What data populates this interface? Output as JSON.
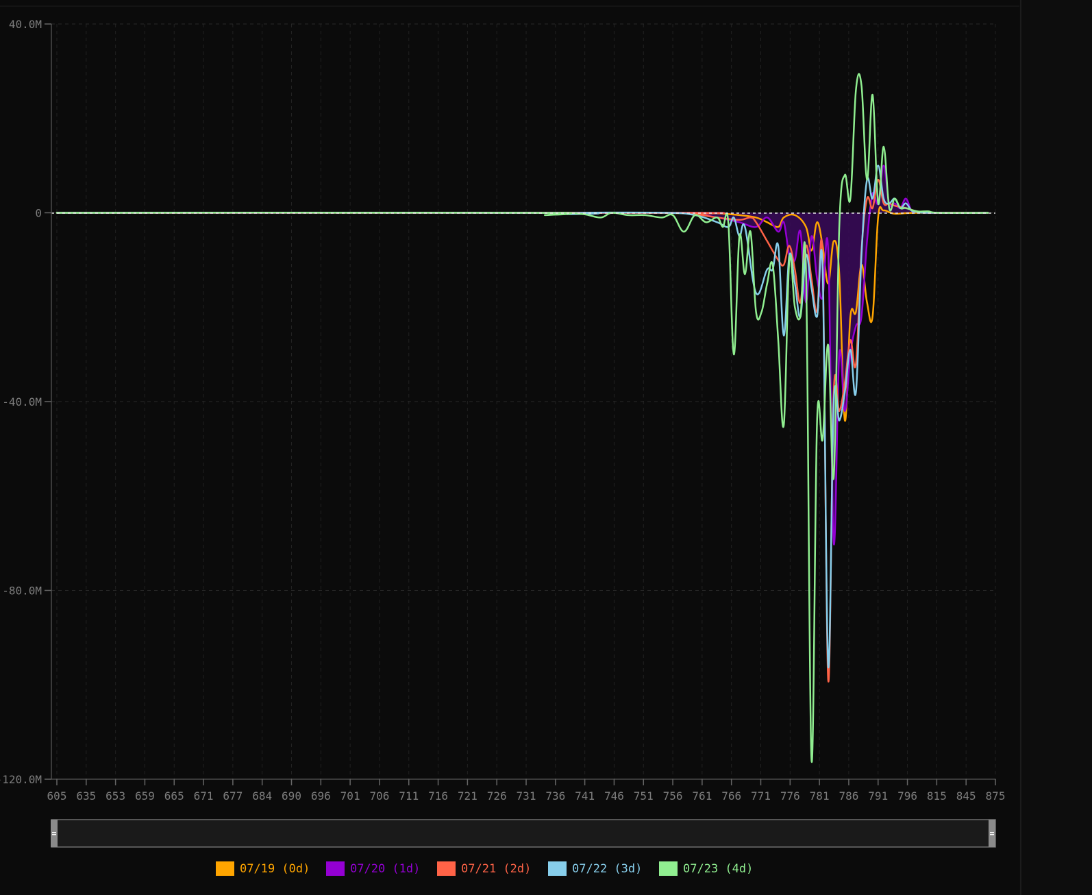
{
  "chart_data": {
    "type": "line",
    "title": "",
    "xlabel": "",
    "ylabel": "",
    "ylim": [
      -120000000,
      40000000
    ],
    "grid": true,
    "legend": "bottom-center",
    "y_ticks": [
      {
        "value": 40000000,
        "label": "40.0M"
      },
      {
        "value": 0,
        "label": "0"
      },
      {
        "value": -40000000,
        "label": "-40.0M"
      },
      {
        "value": -80000000,
        "label": "-80.0M"
      },
      {
        "value": -120000000,
        "label": "-120.0M"
      }
    ],
    "categories": [
      "605",
      "635",
      "653",
      "659",
      "665",
      "671",
      "677",
      "684",
      "690",
      "696",
      "701",
      "706",
      "711",
      "716",
      "721",
      "726",
      "731",
      "736",
      "741",
      "746",
      "751",
      "756",
      "761",
      "766",
      "771",
      "776",
      "781",
      "786",
      "791",
      "796",
      "815",
      "845",
      "875"
    ],
    "series": [
      {
        "name": "07/19 (0d)",
        "color": "#ffa500",
        "points": [
          [
            605,
            0
          ],
          [
            700,
            0
          ],
          [
            720,
            -0.1
          ],
          [
            724,
            -0.1
          ],
          [
            728,
            -0.5
          ],
          [
            731,
            -1.0
          ],
          [
            733,
            -2.0
          ],
          [
            735,
            -3.0
          ],
          [
            736,
            -1.0
          ],
          [
            738,
            -0.5
          ],
          [
            740,
            -3.0
          ],
          [
            741,
            -8.0
          ],
          [
            742,
            -2.0
          ],
          [
            743,
            -7.0
          ],
          [
            744,
            -15.0
          ],
          [
            745,
            -6.0
          ],
          [
            746,
            -13.0
          ],
          [
            747,
            -44.0
          ],
          [
            748,
            -22.0
          ],
          [
            749,
            -21.0
          ],
          [
            750,
            -11.0
          ],
          [
            751,
            -19.0
          ],
          [
            752,
            -22.0
          ],
          [
            753,
            -1.0
          ],
          [
            754,
            0.5
          ],
          [
            756,
            -0.2
          ],
          [
            760,
            0
          ],
          [
            875,
            0
          ]
        ]
      },
      {
        "name": "07/20 (1d)",
        "color": "#9400d3",
        "points": [
          [
            605,
            0
          ],
          [
            715,
            0
          ],
          [
            720,
            -0.2
          ],
          [
            724,
            -1.0
          ],
          [
            728,
            -2.0
          ],
          [
            731,
            -3.0
          ],
          [
            733,
            -1.0
          ],
          [
            735,
            -4.0
          ],
          [
            736,
            -2.0
          ],
          [
            737,
            -9.0
          ],
          [
            738,
            -10.0
          ],
          [
            739,
            -4.0
          ],
          [
            740,
            -19.0
          ],
          [
            741,
            -5.0
          ],
          [
            742,
            -14.0
          ],
          [
            743,
            -18.0
          ],
          [
            744,
            -8.0
          ],
          [
            745,
            -70.0
          ],
          [
            746,
            -30.0
          ],
          [
            747,
            -42.0
          ],
          [
            748,
            -30.0
          ],
          [
            749,
            -24.0
          ],
          [
            750,
            -22.0
          ],
          [
            751,
            -6.0
          ],
          [
            752,
            4.0
          ],
          [
            753,
            2.0
          ],
          [
            754,
            10.0
          ],
          [
            755,
            2.0
          ],
          [
            756,
            2.0
          ],
          [
            757,
            1.0
          ],
          [
            758,
            3.0
          ],
          [
            759,
            0.5
          ],
          [
            760,
            0.2
          ],
          [
            762,
            0
          ],
          [
            875,
            0
          ]
        ]
      },
      {
        "name": "07/21 (2d)",
        "color": "#ff6347",
        "points": [
          [
            605,
            0
          ],
          [
            715,
            0
          ],
          [
            720,
            -0.3
          ],
          [
            724,
            -1.0
          ],
          [
            728,
            -1.5
          ],
          [
            730,
            -1.0
          ],
          [
            731,
            -2.0
          ],
          [
            733,
            -6.0
          ],
          [
            735,
            -10.0
          ],
          [
            736,
            -11.0
          ],
          [
            737,
            -7.0
          ],
          [
            738,
            -12.0
          ],
          [
            739,
            -19.0
          ],
          [
            740,
            -7.0
          ],
          [
            741,
            -14.0
          ],
          [
            742,
            -21.0
          ],
          [
            743,
            -10.0
          ],
          [
            744,
            -99.0
          ],
          [
            745,
            -38.0
          ],
          [
            746,
            -42.0
          ],
          [
            747,
            -36.0
          ],
          [
            748,
            -27.0
          ],
          [
            749,
            -32.0
          ],
          [
            750,
            -8.0
          ],
          [
            751,
            3.0
          ],
          [
            752,
            1.0
          ],
          [
            753,
            7.0
          ],
          [
            754,
            2.0
          ],
          [
            755,
            2.0
          ],
          [
            756,
            1.5
          ],
          [
            758,
            1.0
          ],
          [
            760,
            0.3
          ],
          [
            762,
            0
          ],
          [
            875,
            0
          ]
        ]
      },
      {
        "name": "07/22 (3d)",
        "color": "#87ceeb",
        "points": [
          [
            605,
            0
          ],
          [
            695,
            0
          ],
          [
            697,
            -0.3
          ],
          [
            700,
            0
          ],
          [
            715,
            0
          ],
          [
            720,
            -0.5
          ],
          [
            724,
            -2.0
          ],
          [
            726,
            -3.0
          ],
          [
            727,
            -1.0
          ],
          [
            728,
            -5.0
          ],
          [
            729,
            -3.0
          ],
          [
            731,
            -17.0
          ],
          [
            733,
            -12.0
          ],
          [
            734,
            -12.0
          ],
          [
            735,
            -7.0
          ],
          [
            736,
            -26.0
          ],
          [
            737,
            -9.0
          ],
          [
            738,
            -15.0
          ],
          [
            739,
            -22.0
          ],
          [
            740,
            -9.0
          ],
          [
            741,
            -16.0
          ],
          [
            742,
            -22.0
          ],
          [
            743,
            -12.0
          ],
          [
            744,
            -96.0
          ],
          [
            745,
            -40.0
          ],
          [
            746,
            -44.0
          ],
          [
            747,
            -38.0
          ],
          [
            748,
            -29.0
          ],
          [
            749,
            -38.0
          ],
          [
            750,
            -9.0
          ],
          [
            751,
            7.0
          ],
          [
            752,
            3.0
          ],
          [
            753,
            10.0
          ],
          [
            754,
            3.0
          ],
          [
            755,
            2.0
          ],
          [
            756,
            3.0
          ],
          [
            757,
            1.0
          ],
          [
            758,
            2.0
          ],
          [
            759,
            0.5
          ],
          [
            760,
            0.2
          ],
          [
            762,
            0
          ],
          [
            875,
            0
          ]
        ]
      },
      {
        "name": "07/23 (4d)",
        "color": "#90ee90",
        "points": [
          [
            605,
            0
          ],
          [
            690,
            0
          ],
          [
            693,
            -0.5
          ],
          [
            696,
            0
          ],
          [
            700,
            -0.3
          ],
          [
            703,
            -1.0
          ],
          [
            705,
            0
          ],
          [
            708,
            -0.5
          ],
          [
            711,
            -0.5
          ],
          [
            714,
            -1.0
          ],
          [
            716,
            -0.5
          ],
          [
            718,
            -4.0
          ],
          [
            720,
            -0.5
          ],
          [
            722,
            -2.0
          ],
          [
            724,
            -1.0
          ],
          [
            725,
            -3.0
          ],
          [
            726,
            -2.0
          ],
          [
            727,
            -30.0
          ],
          [
            728,
            -5.0
          ],
          [
            729,
            -13.0
          ],
          [
            730,
            -4.0
          ],
          [
            731,
            -21.0
          ],
          [
            732,
            -21.0
          ],
          [
            733,
            -15.0
          ],
          [
            734,
            -11.0
          ],
          [
            735,
            -27.0
          ],
          [
            736,
            -45.0
          ],
          [
            737,
            -10.0
          ],
          [
            738,
            -20.0
          ],
          [
            739,
            -22.0
          ],
          [
            740,
            -12.0
          ],
          [
            741,
            -116.0
          ],
          [
            742,
            -44.0
          ],
          [
            743,
            -48.0
          ],
          [
            744,
            -28.0
          ],
          [
            745,
            -56.0
          ],
          [
            746,
            -3.0
          ],
          [
            747,
            8.0
          ],
          [
            748,
            3.0
          ],
          [
            749,
            26.0
          ],
          [
            750,
            27.0
          ],
          [
            751,
            7.0
          ],
          [
            752,
            25.0
          ],
          [
            753,
            2.0
          ],
          [
            754,
            14.0
          ],
          [
            755,
            1.0
          ],
          [
            756,
            3.0
          ],
          [
            757,
            1.0
          ],
          [
            758,
            1.0
          ],
          [
            760,
            0.3
          ],
          [
            762,
            0.3
          ],
          [
            764,
            0
          ],
          [
            875,
            0
          ]
        ]
      }
    ]
  }
}
